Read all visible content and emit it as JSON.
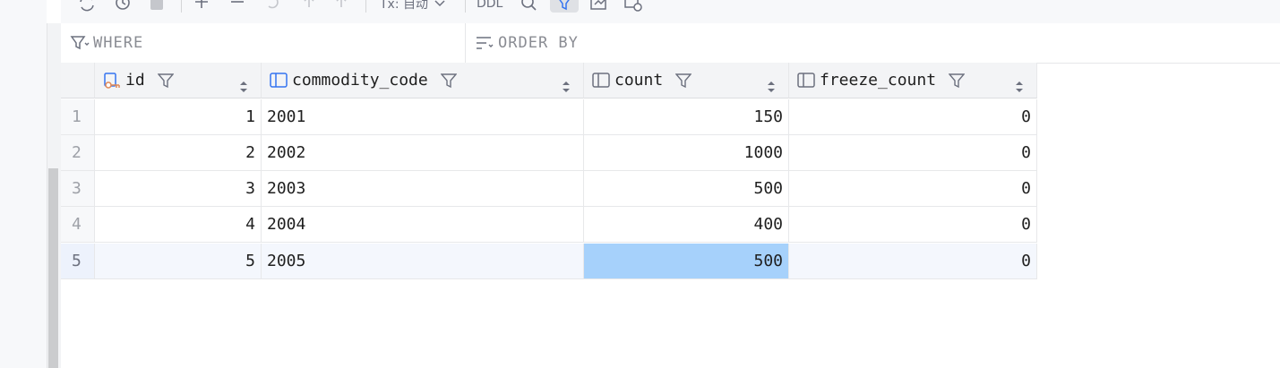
{
  "toolbar": {
    "tx_label": "Tx: 自动",
    "ddl_label": "DDL"
  },
  "filters": {
    "where_label": "WHERE",
    "order_by_label": "ORDER BY"
  },
  "table": {
    "columns": [
      {
        "name": "id",
        "icon": "primary-key-column-icon"
      },
      {
        "name": "commodity_code",
        "icon": "column-icon"
      },
      {
        "name": "count",
        "icon": "column-icon"
      },
      {
        "name": "freeze_count",
        "icon": "column-icon"
      }
    ],
    "rows": [
      {
        "num": "1",
        "id": "1",
        "commodity_code": "2001",
        "count": "150",
        "freeze_count": "0"
      },
      {
        "num": "2",
        "id": "2",
        "commodity_code": "2002",
        "count": "1000",
        "freeze_count": "0"
      },
      {
        "num": "3",
        "id": "3",
        "commodity_code": "2003",
        "count": "500",
        "freeze_count": "0"
      },
      {
        "num": "4",
        "id": "4",
        "commodity_code": "2004",
        "count": "400",
        "freeze_count": "0"
      },
      {
        "num": "5",
        "id": "5",
        "commodity_code": "2005",
        "count": "500",
        "freeze_count": "0"
      }
    ],
    "selected_row": 5,
    "selected_column": "count"
  },
  "colors": {
    "selected_cell": "#a6d1fb",
    "header_bg": "#f3f4f6"
  }
}
